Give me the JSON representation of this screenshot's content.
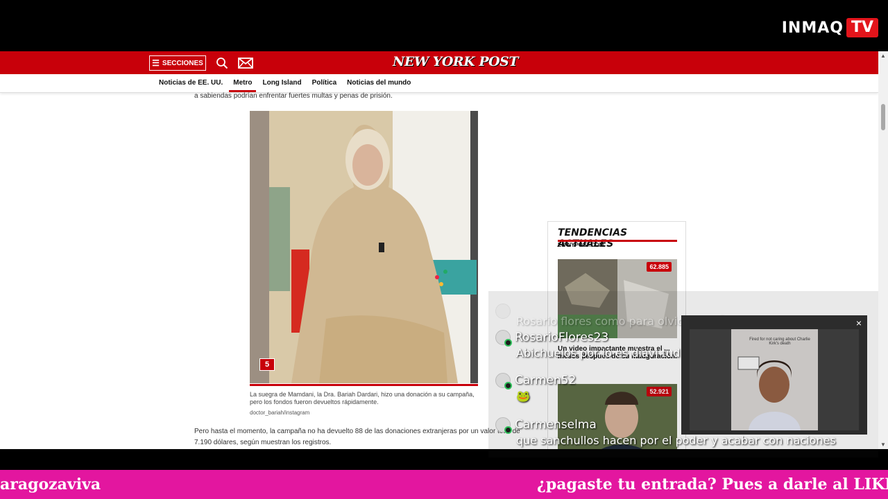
{
  "overlay": {
    "logo_text": "INMAQ",
    "logo_badge": "TV"
  },
  "site": {
    "sections_button": "SECCIONES",
    "logo": "NEW YORK POST",
    "nav": [
      {
        "label": "Noticias de EE. UU.",
        "active": false
      },
      {
        "label": "Metro",
        "active": true
      },
      {
        "label": "Long Island",
        "active": false
      },
      {
        "label": "Política",
        "active": false
      },
      {
        "label": "Noticias del mundo",
        "active": false
      }
    ]
  },
  "article": {
    "paragraph_top": "a sabiendas podrían enfrentar fuertes multas y penas de prisión.",
    "photo_badge": "5",
    "caption": "La suegra de Mamdani, la Dra. Bariah Dardari, hizo una donación a su campaña, pero los fondos fueron devueltos rápidamente.",
    "credit": "doctor_bariah/instagram",
    "paragraph_bottom": "Pero hasta el momento, la campaña no ha devuelto 88 de las donaciones extranjeras por un valor total de 7.190 dólares, según muestran los registros."
  },
  "trending": {
    "title": "TENDENCIAS ACTUALES",
    "subtitle": "EN NYPOST.COM",
    "items": [
      {
        "views": "62.885",
        "headline": "Un video impactante muestra el ... meses después de su inauguración."
      },
      {
        "views": "52.921"
      }
    ]
  },
  "chat": {
    "messages": [
      {
        "user": "",
        "text": "Rosario flores como para olvidarnos🤣",
        "faded": true
      },
      {
        "user": "RosarioFlores23",
        "text": "Abichuelos por lo es diavi tud jajaja hdp"
      },
      {
        "user": "Carmen52",
        "text": "🐸"
      },
      {
        "user": "Carmenselma",
        "text": "que sanchullos hacen por el poder y acabar con naciones"
      }
    ]
  },
  "video": {
    "close": "×",
    "frame_text": "Fired for not caring about Charlie Kirk's death"
  },
  "ticker": {
    "left": "aragozaviva",
    "right": "¿pagaste tu entrada? Pues a darle al LIKE / A"
  }
}
